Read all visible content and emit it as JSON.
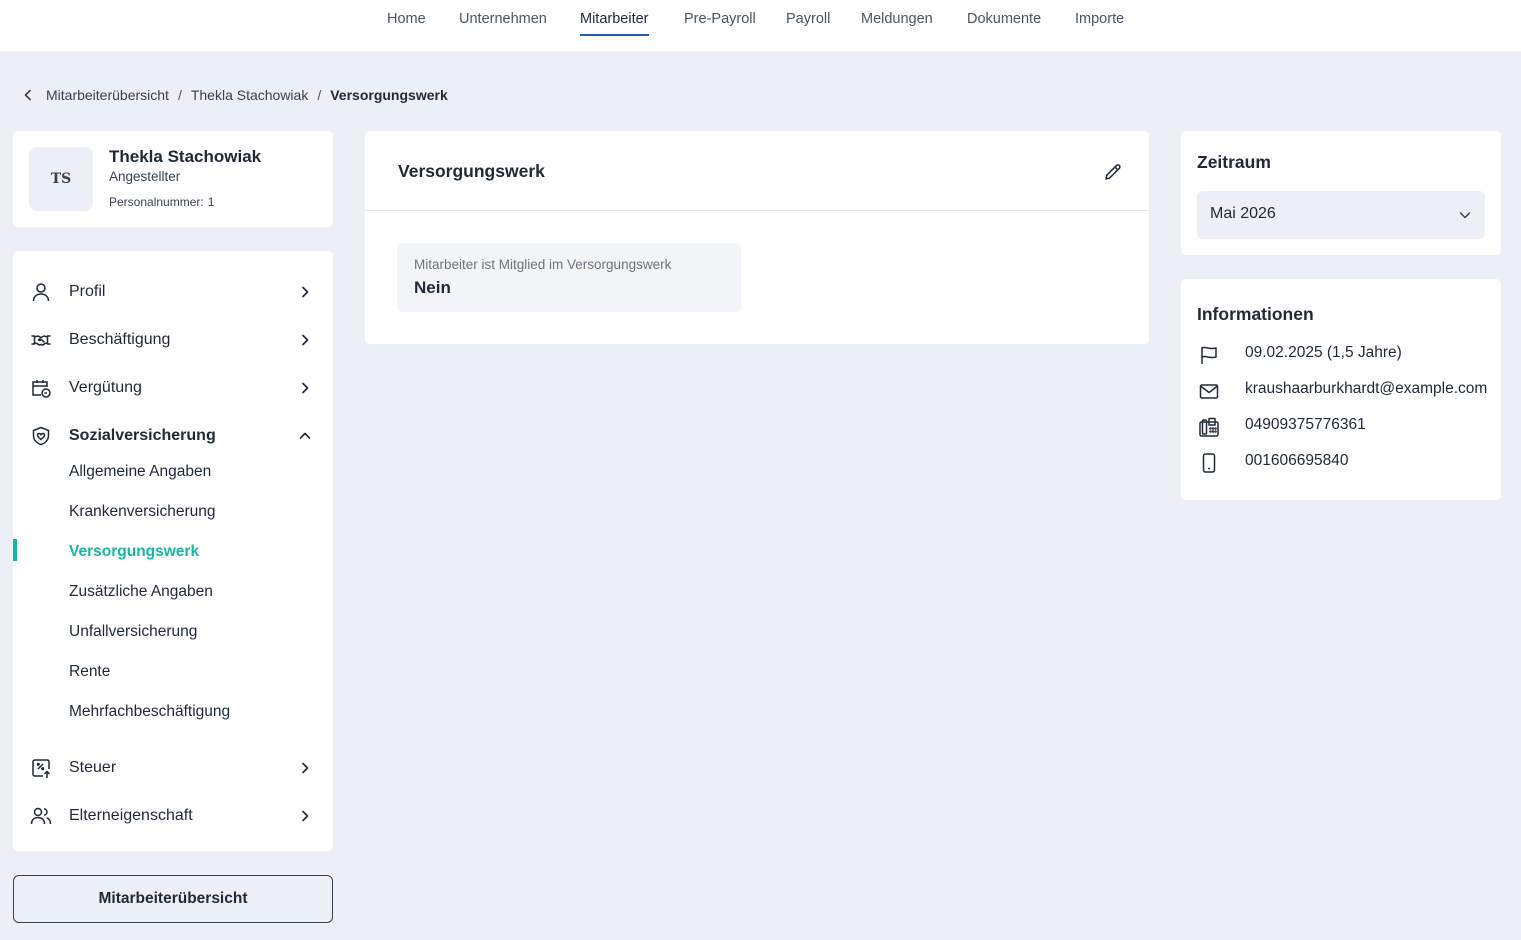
{
  "topnav": {
    "items": [
      {
        "label": "Home"
      },
      {
        "label": "Unternehmen"
      },
      {
        "label": "Mitarbeiter",
        "active": true
      },
      {
        "label": "Pre-Payroll"
      },
      {
        "label": "Payroll"
      },
      {
        "label": "Meldungen"
      },
      {
        "label": "Dokumente"
      },
      {
        "label": "Importe"
      }
    ],
    "active_color": "#1b5fa8"
  },
  "breadcrumb": {
    "items": [
      "Mitarbeiterübersicht",
      "Thekla Stachowiak"
    ],
    "current": "Versorgungswerk",
    "separator": "/"
  },
  "profile": {
    "initials": "TS",
    "name": "Thekla Stachowiak",
    "role": "Angestellter",
    "personnel_label": "Personalnummer:",
    "personnel_number": "1"
  },
  "sidenav": {
    "items": [
      {
        "label": "Profil",
        "icon": "user-icon"
      },
      {
        "label": "Beschäftigung",
        "icon": "handshake-icon"
      },
      {
        "label": "Vergütung",
        "icon": "calendar-money-icon"
      },
      {
        "label": "Sozialversicherung",
        "icon": "shield-heart-icon",
        "expanded": true
      },
      {
        "label": "Steuer",
        "icon": "tax-icon"
      },
      {
        "label": "Elterneigenschaft",
        "icon": "users-icon"
      }
    ],
    "subitems": [
      {
        "label": "Allgemeine Angaben"
      },
      {
        "label": "Krankenversicherung"
      },
      {
        "label": "Versorgungswerk",
        "active": true
      },
      {
        "label": "Zusätzliche Angaben"
      },
      {
        "label": "Unfallversicherung"
      },
      {
        "label": "Rente"
      },
      {
        "label": "Mehrfachbeschäftigung"
      }
    ],
    "active_color": "#14b8a6"
  },
  "overview_button": {
    "label": "Mitarbeiterübersicht"
  },
  "main": {
    "title": "Versorgungswerk",
    "edit_icon": "pencil-icon",
    "field": {
      "label": "Mitarbeiter ist Mitglied im Versorgungswerk",
      "value": "Nein"
    }
  },
  "zeitraum": {
    "title": "Zeitraum",
    "selected": "Mai 2026"
  },
  "info": {
    "title": "Informationen",
    "rows": [
      {
        "icon": "flag-icon",
        "text": "09.02.2025 (1,5 Jahre)"
      },
      {
        "icon": "mail-icon",
        "text": "kraushaarburkhardt@example.com"
      },
      {
        "icon": "phone-landline-icon",
        "text": "04909375776361"
      },
      {
        "icon": "mobile-phone-icon",
        "text": "001606695840"
      }
    ]
  }
}
